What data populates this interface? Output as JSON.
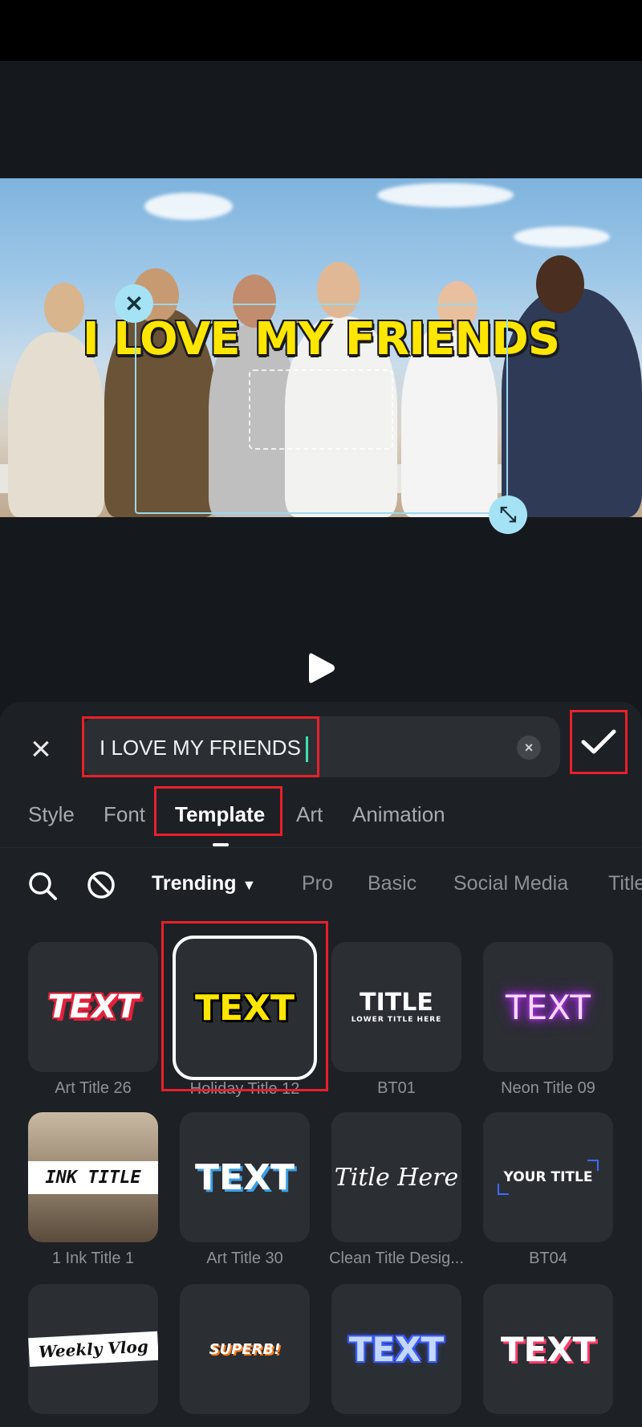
{
  "preview": {
    "overlay_text": "I LOVE MY FRIENDS"
  },
  "editor": {
    "input_value": "I LOVE MY FRIENDS"
  },
  "tabs": [
    {
      "label": "Style"
    },
    {
      "label": "Font"
    },
    {
      "label": "Template"
    },
    {
      "label": "Art"
    },
    {
      "label": "Animation"
    }
  ],
  "active_tab": "Template",
  "categories": [
    {
      "label": "Trending"
    },
    {
      "label": "Pro"
    },
    {
      "label": "Basic"
    },
    {
      "label": "Social Media"
    },
    {
      "label": "Title"
    }
  ],
  "templates": [
    {
      "name": "Art Title 26",
      "preview": "TEXT"
    },
    {
      "name": "Holiday Title 12",
      "preview": "TEXT"
    },
    {
      "name": "BT01",
      "preview": "TITLE",
      "preview_sub": "LOWER TITLE HERE"
    },
    {
      "name": "Neon Title 09",
      "preview": "TEXT"
    },
    {
      "name": "1 Ink Title 1",
      "preview": "INK TITLE"
    },
    {
      "name": "Art Title 30",
      "preview": "TEXT"
    },
    {
      "name": "Clean Title Desig...",
      "preview": "Title Here"
    },
    {
      "name": "BT04",
      "preview": "YOUR TITLE"
    },
    {
      "name": "",
      "preview": "Weekly Vlog"
    },
    {
      "name": "",
      "preview": "SUPERB!"
    },
    {
      "name": "",
      "preview": "TEXT"
    },
    {
      "name": "",
      "preview": "TEXT"
    }
  ],
  "colors": {
    "accent": "#3ee0b0",
    "highlight": "#e8202a",
    "overlay_text": "#ffe600"
  },
  "icons": {
    "close": "close-icon",
    "confirm": "checkmark-icon",
    "search": "search-icon",
    "none": "no-style-icon",
    "play": "play-icon",
    "dropdown": "caret-down-icon"
  }
}
